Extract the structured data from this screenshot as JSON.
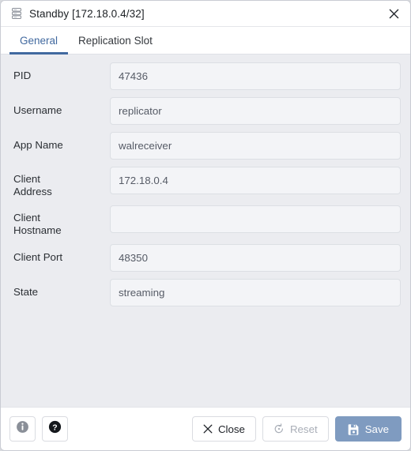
{
  "window": {
    "title": "Standby [172.18.0.4/32]",
    "icon": "server-rack-icon",
    "close_icon": "close-icon"
  },
  "tabs": [
    {
      "label": "General",
      "active": true
    },
    {
      "label": "Replication Slot",
      "active": false
    }
  ],
  "form": {
    "fields": [
      {
        "label": "PID",
        "value": "47436",
        "placeholder": ""
      },
      {
        "label": "Username",
        "value": "replicator",
        "placeholder": ""
      },
      {
        "label": "App Name",
        "value": "walreceiver",
        "placeholder": ""
      },
      {
        "label": "Client\nAddress",
        "value": "172.18.0.4",
        "placeholder": ""
      },
      {
        "label": "Client\nHostname",
        "value": "",
        "placeholder": ""
      },
      {
        "label": "Client Port",
        "value": "48350",
        "placeholder": ""
      },
      {
        "label": "State",
        "value": "streaming",
        "placeholder": ""
      }
    ]
  },
  "footer": {
    "info_icon": "info-icon",
    "help_icon": "help-icon",
    "close_label": "Close",
    "close_icon": "close-x-icon",
    "reset_label": "Reset",
    "reset_icon": "reset-revert-icon",
    "reset_disabled": true,
    "save_label": "Save",
    "save_icon": "floppy-disk-save-icon",
    "save_disabled": true
  },
  "colors": {
    "accent": "#41699f",
    "body_bg": "#ebecf0",
    "field_bg": "#f3f4f7",
    "save_bg": "#7f9bc0"
  }
}
